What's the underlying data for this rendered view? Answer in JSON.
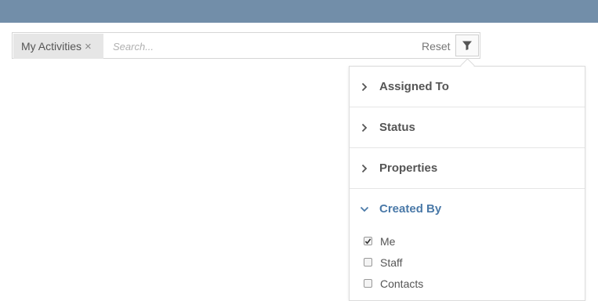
{
  "search": {
    "chip_label": "My Activities",
    "chip_remove_glyph": "×",
    "placeholder": "Search...",
    "value": "",
    "reset_label": "Reset",
    "filter_icon": "funnel-icon"
  },
  "filter_panel": {
    "sections": [
      {
        "label": "Assigned To",
        "expanded": false
      },
      {
        "label": "Status",
        "expanded": false
      },
      {
        "label": "Properties",
        "expanded": false
      },
      {
        "label": "Created By",
        "expanded": true
      }
    ],
    "created_by_options": [
      {
        "label": "Me",
        "checked": true
      },
      {
        "label": "Staff",
        "checked": false
      },
      {
        "label": "Contacts",
        "checked": false
      }
    ]
  },
  "colors": {
    "topbar": "#728ea9",
    "accent": "#4a79a8",
    "text": "#555555"
  }
}
